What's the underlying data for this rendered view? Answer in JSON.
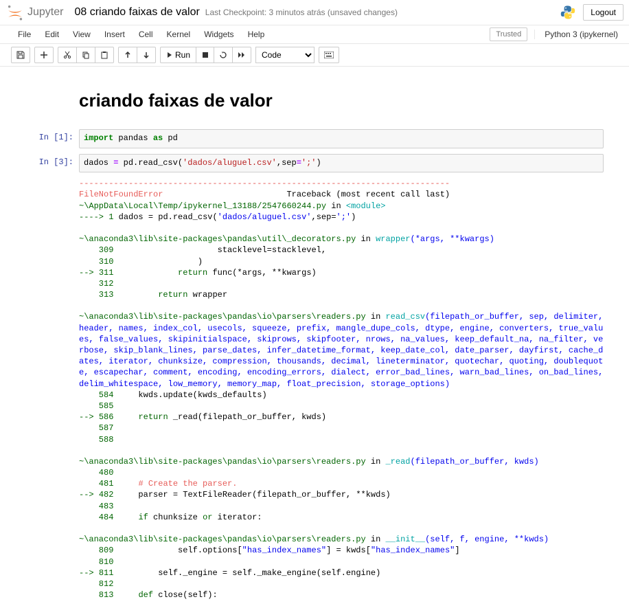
{
  "header": {
    "logo_text": "Jupyter",
    "notebook_name": "08 criando faixas de valor",
    "checkpoint": "Last Checkpoint: 3 minutos atrás  (unsaved changes)",
    "logout": "Logout"
  },
  "menubar": {
    "items": [
      "File",
      "Edit",
      "View",
      "Insert",
      "Cell",
      "Kernel",
      "Widgets",
      "Help"
    ],
    "trusted": "Trusted",
    "kernel": "Python 3 (ipykernel)"
  },
  "toolbar": {
    "run_label": "Run",
    "celltype": "Code"
  },
  "markdown": {
    "h1": "criando faixas de valor"
  },
  "cells": {
    "c1": {
      "prompt": "In [1]:",
      "kw1": "import",
      "t1": " pandas ",
      "kw2": "as",
      "t2": " pd"
    },
    "c2": {
      "prompt": "In [3]:",
      "t1": "dados ",
      "op1": "=",
      "t2": " pd.read_csv(",
      "s1": "'dados/aluguel.csv'",
      "t3": ",sep",
      "op2": "=",
      "s2": "';'",
      "t4": ")"
    }
  },
  "traceback": {
    "dash": "---------------------------------------------------------------------------",
    "errname": "FileNotFoundError",
    "tbtext": "                         Traceback (most recent call last)",
    "mod_path": "~\\AppData\\Local\\Temp/ipykernel_13188/2547660244.py",
    "in_txt": " in ",
    "module_tag": "<module>",
    "l_arrow": "----> ",
    "l1_num": "1",
    "l1_a": " dados ",
    "l1_op": "=",
    "l1_b": " pd",
    "l1_dot": ".",
    "l1_c": "read_csv",
    "l1_p1": "(",
    "l1_s1": "'dados/aluguel.csv'",
    "l1_com": ",",
    "l1_d": "sep",
    "l1_op2": "=",
    "l1_s2": "';'",
    "l1_p2": ")",
    "f1_path": "~\\anaconda3\\lib\\site-packages\\pandas\\util\\_decorators.py",
    "f1_func": "wrapper",
    "f1_args": "(*args, **kwargs)",
    "f1_309": "    309",
    "f1_309b": "                     stacklevel",
    "f1_309op": "=",
    "f1_309c": "stacklevel",
    "f1_309d": ",",
    "f1_310": "    310",
    "f1_310b": "                 )",
    "f1_arrow": "--> ",
    "f1_311": "311",
    "f1_311b": "             ",
    "f1_311kw": "return",
    "f1_311c": " func",
    "f1_311p": "(",
    "f1_311op": "*",
    "f1_311d": "args",
    "f1_311cm": ",",
    "f1_311sp": " ",
    "f1_311op2": "**",
    "f1_311e": "kwargs",
    "f1_311p2": ")",
    "f1_312": "    312",
    "f1_313": "    313",
    "f1_313b": "         ",
    "f1_313kw": "return",
    "f1_313c": " wrapper",
    "f2_path": "~\\anaconda3\\lib\\site-packages\\pandas\\io\\parsers\\readers.py",
    "f2_func": "read_csv",
    "f2_args": "(filepath_or_buffer, sep, delimiter, header, names, index_col, usecols, squeeze, prefix, mangle_dupe_cols, dtype, engine, converters, true_values, false_values, skipinitialspace, skiprows, skipfooter, nrows, na_values, keep_default_na, na_filter, verbose, skip_blank_lines, parse_dates, infer_datetime_format, keep_date_col, date_parser, dayfirst, cache_dates, iterator, chunksize, compression, thousands, decimal, lineterminator, quotechar, quoting, doublequote, escapechar, comment, encoding, encoding_errors, dialect, error_bad_lines, warn_bad_lines, on_bad_lines, delim_whitespace, low_memory, memory_map, float_precision, storage_options)",
    "f2_584": "    584",
    "f2_584b": "     kwds",
    "f2_584d": ".",
    "f2_584c": "update",
    "f2_584p": "(",
    "f2_584e": "kwds_defaults",
    "f2_584p2": ")",
    "f2_585": "    585",
    "f2_586": "586",
    "f2_586b": "     ",
    "f2_586kw": "return",
    "f2_586c": " _read",
    "f2_586p": "(",
    "f2_586d": "filepath_or_buffer",
    "f2_586cm": ",",
    "f2_586e": " kwds",
    "f2_586p2": ")",
    "f2_587": "    587",
    "f2_588": "    588",
    "f3_func": "_read",
    "f3_args": "(filepath_or_buffer, kwds)",
    "f3_480": "    480",
    "f3_481": "    481",
    "f3_481b": "     ",
    "f3_481c": "# Create the parser.",
    "f3_482": "482",
    "f3_482b": "     parser ",
    "f3_482op": "=",
    "f3_482c": " TextFileReader",
    "f3_482p": "(",
    "f3_482d": "filepath_or_buffer",
    "f3_482cm": ",",
    "f3_482sp": " ",
    "f3_482op2": "**",
    "f3_482e": "kwds",
    "f3_482p2": ")",
    "f3_483": "    483",
    "f3_484": "    484",
    "f3_484b": "     ",
    "f3_484kw": "if",
    "f3_484c": " chunksize ",
    "f3_484kw2": "or",
    "f3_484d": " iterator",
    "f3_484e": ":",
    "f4_func": "__init__",
    "f4_args": "(self, f, engine, **kwds)",
    "f4_809": "    809",
    "f4_809b": "             self",
    "f4_809d1": ".",
    "f4_809c": "options",
    "f4_809p": "[",
    "f4_809s": "\"has_index_names\"",
    "f4_809p2": "]",
    "f4_809sp": " ",
    "f4_809op": "=",
    "f4_809e": " kwds",
    "f4_809p3": "[",
    "f4_809s2": "\"has_index_names\"",
    "f4_809p4": "]",
    "f4_810": "    810",
    "f4_811": "811",
    "f4_811b": "         self",
    "f4_811d1": ".",
    "f4_811c": "_engine ",
    "f4_811op": "=",
    "f4_811e": " self",
    "f4_811d2": ".",
    "f4_811f": "_make_engine",
    "f4_811p": "(",
    "f4_811g": "self",
    "f4_811d3": ".",
    "f4_811h": "engine",
    "f4_811p2": ")",
    "f4_812": "    812",
    "f4_813": "    813",
    "f4_813b": "     ",
    "f4_813kw": "def",
    "f4_813c": " close",
    "f4_813p": "(",
    "f4_813d": "self",
    "f4_813p2": ")",
    "f4_813e": ":"
  }
}
